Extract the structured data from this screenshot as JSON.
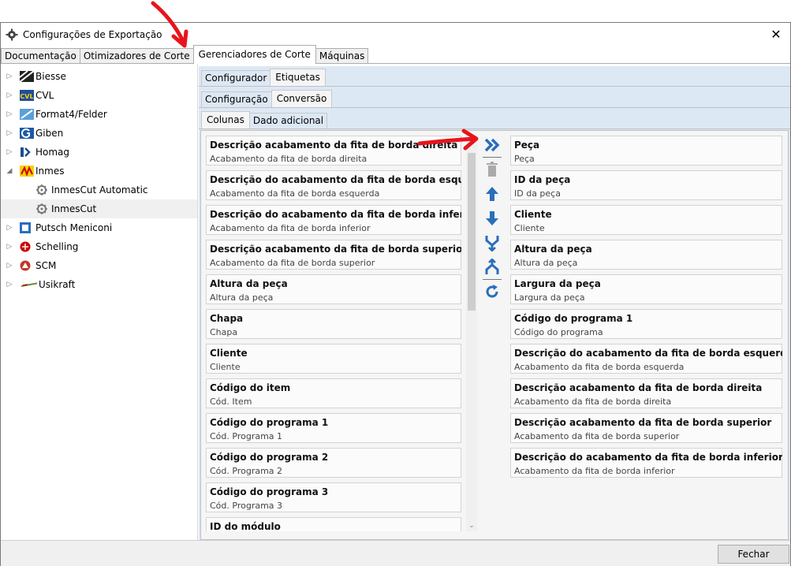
{
  "window": {
    "title": "Configurações de Exportação"
  },
  "main_tabs": [
    {
      "label": "Documentação"
    },
    {
      "label": "Otimizadores de Corte"
    },
    {
      "label": "Gerenciadores de Corte"
    },
    {
      "label": "Máquinas"
    }
  ],
  "tree": {
    "items": [
      {
        "label": "Biesse"
      },
      {
        "label": "CVL"
      },
      {
        "label": "Format4/Felder"
      },
      {
        "label": "Giben"
      },
      {
        "label": "Homag"
      },
      {
        "label": "Inmes"
      },
      {
        "label": "InmesCut Automatic"
      },
      {
        "label": "InmesCut"
      },
      {
        "label": "Putsch Meniconi"
      },
      {
        "label": "Schelling"
      },
      {
        "label": "SCM"
      },
      {
        "label": "Usikraft"
      }
    ],
    "logo_text_cvl": "CVL"
  },
  "sub_tabs_1": [
    {
      "label": "Configurador"
    },
    {
      "label": "Etiquetas"
    }
  ],
  "sub_tabs_2": [
    {
      "label": "Configuração"
    },
    {
      "label": "Conversão"
    }
  ],
  "sub_tabs_3": [
    {
      "label": "Colunas"
    },
    {
      "label": "Dado adicional"
    }
  ],
  "available_columns": [
    {
      "title": "Descrição acabamento da fita de borda direita",
      "sub": "Acabamento da fita de borda direita"
    },
    {
      "title": "Descrição do acabamento da fita de borda esquerda",
      "sub": "Acabamento da fita de borda esquerda"
    },
    {
      "title": "Descrição do acabamento da fita de borda inferior",
      "sub": "Acabamento da fita de borda inferior"
    },
    {
      "title": "Descrição acabamento da fita de borda superior",
      "sub": "Acabamento da fita de borda superior"
    },
    {
      "title": "Altura da peça",
      "sub": "Altura da peça"
    },
    {
      "title": "Chapa",
      "sub": "Chapa"
    },
    {
      "title": "Cliente",
      "sub": "Cliente"
    },
    {
      "title": "Código do item",
      "sub": "Cód. Item"
    },
    {
      "title": "Código do programa 1",
      "sub": "Cód. Programa 1"
    },
    {
      "title": "Código do programa 2",
      "sub": "Cód. Programa 2"
    },
    {
      "title": "Código do programa 3",
      "sub": "Cód. Programa 3"
    },
    {
      "title": "ID do módulo",
      "sub": ""
    }
  ],
  "selected_columns": [
    {
      "title": "Peça",
      "sub": "Peça"
    },
    {
      "title": "ID da peça",
      "sub": "ID da peça"
    },
    {
      "title": "Cliente",
      "sub": "Cliente"
    },
    {
      "title": "Altura da peça",
      "sub": "Altura da peça"
    },
    {
      "title": "Largura da peça",
      "sub": "Largura da peça"
    },
    {
      "title": "Código do programa 1",
      "sub": "Código do programa"
    },
    {
      "title": "Descrição do acabamento da fita de borda esquerda",
      "sub": "Acabamento da fita de borda esquerda"
    },
    {
      "title": "Descrição acabamento da fita de borda direita",
      "sub": "Acabamento da fita de borda direita"
    },
    {
      "title": "Descrição acabamento da fita de borda superior",
      "sub": "Acabamento da fita de borda superior"
    },
    {
      "title": "Descrição do acabamento da fita de borda inferior",
      "sub": "Acabamento da fita de borda inferior"
    }
  ],
  "footer": {
    "close_label": "Fechar"
  },
  "colors": {
    "accent_blue": "#2a6ebb",
    "pane_bg": "#dde8f5",
    "annotation_red": "#e8141c"
  }
}
